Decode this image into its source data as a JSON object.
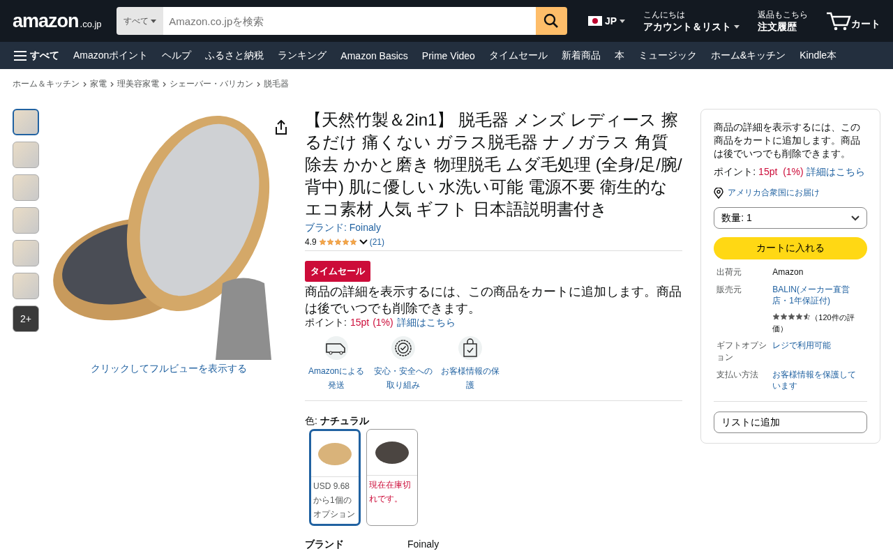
{
  "header": {
    "logo": "amazon",
    "logo_suffix": ".co.jp",
    "search_category": "すべて",
    "search_placeholder": "Amazon.co.jpを検索",
    "language": "JP",
    "account_greeting": "こんにちは",
    "account_label": "アカウント＆リスト",
    "orders_top": "返品もこちら",
    "orders_label": "注文履歴",
    "cart_label": "カート"
  },
  "nav": {
    "menu_label": "すべて",
    "items": [
      "Amazonポイント",
      "ヘルプ",
      "ふるさと納税",
      "ランキング",
      "Amazon Basics",
      "Prime Video",
      "タイムセール",
      "新着商品",
      "本",
      "ミュージック",
      "ホーム&キッチン",
      "Kindle本"
    ]
  },
  "breadcrumbs": [
    "ホーム＆キッチン",
    "家電",
    "理美容家電",
    "シェーバー・バリカン",
    "脱毛器"
  ],
  "gallery": {
    "thumbnails": [
      {
        "selected": true
      },
      {
        "selected": false
      },
      {
        "selected": false
      },
      {
        "selected": false
      },
      {
        "selected": false
      },
      {
        "selected": false
      }
    ],
    "more_label": "2+",
    "full_view_link": "クリックしてフルビューを表示する"
  },
  "product": {
    "title": "【天然竹製＆2in1】 脱毛器 メンズ レディース 擦るだけ 痛くない ガラス脱毛器 ナノガラス 角質除去 かかと磨き 物理脱毛 ムダ毛処理 (全身/足/腕/背中) 肌に優しい 水洗い可能 電源不要 衛生的なエコ素材 人気 ギフト 日本語説明書付き",
    "brand_link": "ブランド: Foinaly",
    "rating": "4.9",
    "stars": 5,
    "review_count": "(21)",
    "deal_badge": "タイムセール",
    "price_note": "商品の詳細を表示するには、この商品をカートに追加します。商品は後でいつでも削除できます。",
    "points_label": "ポイント:",
    "points_value": "15pt",
    "points_percent": "(1%)",
    "points_link": "詳細はこちら",
    "features": [
      {
        "kind": "delivery",
        "label": "Amazonによる発送"
      },
      {
        "kind": "safety",
        "label": "安心・安全への取り組み"
      },
      {
        "kind": "privacy",
        "label": "お客様情報の保護"
      }
    ],
    "color_label": "色:",
    "color_value": "ナチュラル",
    "variants": [
      {
        "selected": true,
        "available": true,
        "color": "#d9b37a",
        "text": "USD 9.68から1個のオプション"
      },
      {
        "selected": false,
        "available": false,
        "color": "#4b4541",
        "text": "現在在庫切れです。"
      }
    ],
    "spec_rows": [
      {
        "label": "ブランド",
        "value": "Foinaly"
      }
    ]
  },
  "buy_box": {
    "price_note": "商品の詳細を表示するには、この商品をカートに追加します。商品は後でいつでも削除できます。",
    "points_label": "ポイント:",
    "points_value": "15pt",
    "points_percent": "(1%)",
    "points_link": "詳細はこちら",
    "delivery_link": "アメリカ合衆国にお届け",
    "quantity": "数量:  1",
    "add_to_cart": "カートに入れる",
    "rows": [
      {
        "kind": "text",
        "label": "出荷元",
        "value": "Amazon"
      },
      {
        "kind": "link",
        "label": "販売元",
        "value": "BALIN(メーカー直営店・1年保証付)"
      },
      {
        "kind": "rating",
        "stars": 4.5,
        "reviews": "（120件の評価）"
      },
      {
        "kind": "link",
        "label": "ギフトオプション",
        "value": "レジで利用可能"
      },
      {
        "kind": "link",
        "label": "支払い方法",
        "value": "お客様情報を保護しています"
      }
    ],
    "add_to_list": "リストに追加"
  }
}
